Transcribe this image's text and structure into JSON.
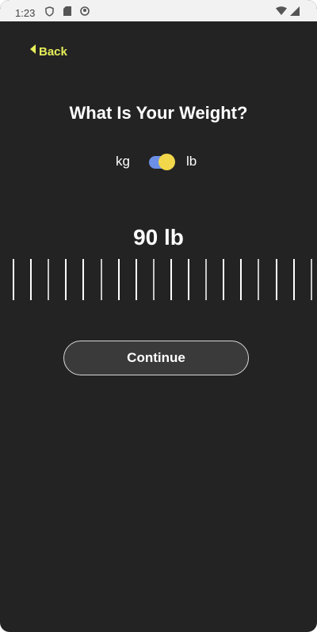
{
  "status_bar": {
    "time": "1:23",
    "left_icons": [
      "shield-icon",
      "sd-card-icon",
      "notification-icon"
    ],
    "right_icons": [
      "wifi-icon",
      "cellular-signal-icon"
    ]
  },
  "nav": {
    "back_label": "Back"
  },
  "screen": {
    "title": "What Is Your Weight?"
  },
  "units": {
    "left": "kg",
    "right": "lb",
    "selected": "lb"
  },
  "weight": {
    "display": "90 lb",
    "value": 90,
    "unit": "lb"
  },
  "actions": {
    "continue_label": "Continue"
  },
  "colors": {
    "background": "#232323",
    "accent": "#e6ef5a",
    "toggle_track": "#6b8fe6",
    "toggle_knob": "#f2d74a"
  }
}
